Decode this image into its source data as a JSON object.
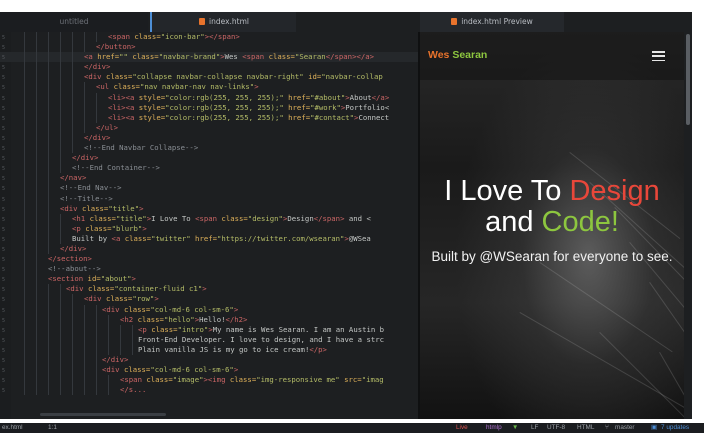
{
  "tabs": {
    "untitled": "untitled",
    "index": "index.html",
    "preview": "index.html Preview"
  },
  "editor": {
    "lines": [
      {
        "indent": 108,
        "tokens": [
          [
            "t",
            "<span"
          ],
          [
            "a",
            " class="
          ],
          [
            "s",
            "\"icon-bar\""
          ],
          [
            "t",
            "></span>"
          ]
        ]
      },
      {
        "indent": 96,
        "tokens": [
          [
            "t",
            "</button>"
          ]
        ]
      },
      {
        "indent": 84,
        "tokens": [
          [
            "t",
            "<a"
          ],
          [
            "a",
            " href="
          ],
          [
            "s",
            "\"\""
          ],
          [
            "a",
            " class="
          ],
          [
            "s",
            "\"navbar-brand\""
          ],
          [
            "t",
            ">"
          ],
          [
            "x",
            "Wes "
          ],
          [
            "t",
            "<span"
          ],
          [
            "a",
            " class="
          ],
          [
            "s",
            "\"Searan"
          ],
          [
            "t",
            "</span></a>"
          ]
        ]
      },
      {
        "indent": 84,
        "tokens": [
          [
            "t",
            "</div>"
          ]
        ]
      },
      {
        "indent": 84,
        "tokens": [
          [
            "t",
            "<div"
          ],
          [
            "a",
            " class="
          ],
          [
            "s",
            "\"collapse navbar-collapse navbar-right\""
          ],
          [
            "a",
            " id="
          ],
          [
            "s",
            "\"navbar-collap"
          ]
        ]
      },
      {
        "indent": 96,
        "tokens": [
          [
            "t",
            "<ul"
          ],
          [
            "a",
            " class="
          ],
          [
            "s",
            "\"nav navbar-nav nav-links\""
          ],
          [
            "t",
            ">"
          ]
        ]
      },
      {
        "indent": 108,
        "tokens": [
          [
            "t",
            "<li><a"
          ],
          [
            "a",
            " style="
          ],
          [
            "s",
            "\"color:rgb(255, 255, 255);\""
          ],
          [
            "a",
            " href="
          ],
          [
            "s",
            "\"#about\""
          ],
          [
            "t",
            ">"
          ],
          [
            "x",
            "About"
          ],
          [
            "t",
            "</a>"
          ]
        ]
      },
      {
        "indent": 108,
        "tokens": [
          [
            "t",
            "<li><a"
          ],
          [
            "a",
            " style="
          ],
          [
            "s",
            "\"color:rgb(255, 255, 255);\""
          ],
          [
            "a",
            " href="
          ],
          [
            "s",
            "\"#work\""
          ],
          [
            "t",
            ">"
          ],
          [
            "x",
            "Portfolio<"
          ]
        ]
      },
      {
        "indent": 108,
        "tokens": [
          [
            "t",
            "<li><a"
          ],
          [
            "a",
            " style="
          ],
          [
            "s",
            "\"color:rgb(255, 255, 255);\""
          ],
          [
            "a",
            " href="
          ],
          [
            "s",
            "\"#contact\""
          ],
          [
            "t",
            ">"
          ],
          [
            "x",
            "Connect"
          ]
        ]
      },
      {
        "indent": 96,
        "tokens": [
          [
            "t",
            "</ul>"
          ]
        ]
      },
      {
        "indent": 84,
        "tokens": [
          [
            "t",
            "</div>"
          ]
        ]
      },
      {
        "indent": 84,
        "tokens": [
          [
            "c",
            "<!--End Navbar Collapse-->"
          ]
        ]
      },
      {
        "indent": 72,
        "tokens": [
          [
            "t",
            "</div>"
          ]
        ]
      },
      {
        "indent": 72,
        "tokens": [
          [
            "c",
            "<!--End Container-->"
          ]
        ]
      },
      {
        "indent": 60,
        "tokens": [
          [
            "t",
            "</nav>"
          ]
        ]
      },
      {
        "indent": 60,
        "tokens": [
          [
            "c",
            "<!--End Nav-->"
          ]
        ]
      },
      {
        "indent": 60,
        "tokens": [
          [
            "c",
            "<!--Title-->"
          ]
        ]
      },
      {
        "indent": 60,
        "tokens": [
          [
            "t",
            "<div"
          ],
          [
            "a",
            " class="
          ],
          [
            "s",
            "\"title\""
          ],
          [
            "t",
            ">"
          ]
        ]
      },
      {
        "indent": 72,
        "tokens": [
          [
            "t",
            "<h1"
          ],
          [
            "a",
            " class="
          ],
          [
            "s",
            "\"title\""
          ],
          [
            "t",
            ">"
          ],
          [
            "x",
            "I Love To "
          ],
          [
            "t",
            "<span"
          ],
          [
            "a",
            " class="
          ],
          [
            "s",
            "\"design\""
          ],
          [
            "t",
            ">"
          ],
          [
            "x",
            "Design"
          ],
          [
            "t",
            "</span>"
          ],
          [
            "x",
            " and <"
          ]
        ]
      },
      {
        "indent": 72,
        "tokens": [
          [
            "t",
            "<p"
          ],
          [
            "a",
            " class="
          ],
          [
            "s",
            "\"blurb\""
          ],
          [
            "t",
            ">"
          ]
        ]
      },
      {
        "indent": 72,
        "tokens": [
          [
            "x",
            "Built by "
          ],
          [
            "t",
            "<a"
          ],
          [
            "a",
            " class="
          ],
          [
            "s",
            "\"twitter\""
          ],
          [
            "a",
            " href="
          ],
          [
            "s",
            "\"https://twitter.com/wsearan\""
          ],
          [
            "t",
            ">"
          ],
          [
            "x",
            "@WSea"
          ]
        ]
      },
      {
        "indent": 60,
        "tokens": [
          [
            "t",
            "</div>"
          ]
        ]
      },
      {
        "indent": 48,
        "tokens": [
          [
            "t",
            "</section>"
          ]
        ]
      },
      {
        "indent": 48,
        "tokens": [
          [
            "c",
            "<!--about-->"
          ]
        ]
      },
      {
        "indent": 48,
        "tokens": [
          [
            "t",
            "<section"
          ],
          [
            "a",
            " id="
          ],
          [
            "s",
            "\"about\""
          ],
          [
            "t",
            ">"
          ]
        ]
      },
      {
        "indent": 66,
        "tokens": [
          [
            "t",
            "<div"
          ],
          [
            "a",
            " class="
          ],
          [
            "s",
            "\"container-fluid c1\""
          ],
          [
            "t",
            ">"
          ]
        ]
      },
      {
        "indent": 84,
        "tokens": [
          [
            "t",
            "<div"
          ],
          [
            "a",
            " class="
          ],
          [
            "s",
            "\"row\""
          ],
          [
            "t",
            ">"
          ]
        ]
      },
      {
        "indent": 102,
        "tokens": [
          [
            "t",
            "<div"
          ],
          [
            "a",
            " class="
          ],
          [
            "s",
            "\"col-md-6 col-sm-6\""
          ],
          [
            "t",
            ">"
          ]
        ]
      },
      {
        "indent": 120,
        "tokens": [
          [
            "t",
            "<h2"
          ],
          [
            "a",
            " class="
          ],
          [
            "s",
            "\"hello\""
          ],
          [
            "t",
            ">"
          ],
          [
            "x",
            "Hello!"
          ],
          [
            "t",
            "</h2>"
          ]
        ]
      },
      {
        "indent": 138,
        "tokens": [
          [
            "t",
            "<p"
          ],
          [
            "a",
            " class="
          ],
          [
            "s",
            "\"intro\""
          ],
          [
            "t",
            ">"
          ],
          [
            "x",
            "My name is Wes Searan. I am an Austin b"
          ]
        ]
      },
      {
        "indent": 138,
        "tokens": [
          [
            "x",
            "Front-End Developer. I love to design, and I have a strc"
          ]
        ]
      },
      {
        "indent": 138,
        "tokens": [
          [
            "x",
            "Plain vanilla JS is my go to ice cream!"
          ],
          [
            "t",
            "</p>"
          ]
        ]
      },
      {
        "indent": 102,
        "tokens": [
          [
            "t",
            "</div>"
          ]
        ]
      },
      {
        "indent": 102,
        "tokens": [
          [
            "t",
            "<div"
          ],
          [
            "a",
            " class="
          ],
          [
            "s",
            "\"col-md-6 col-sm-6\""
          ],
          [
            "t",
            ">"
          ]
        ]
      },
      {
        "indent": 120,
        "tokens": [
          [
            "t",
            "<span"
          ],
          [
            "a",
            " class="
          ],
          [
            "s",
            "\"image\""
          ],
          [
            "t",
            "><img"
          ],
          [
            "a",
            " class="
          ],
          [
            "s",
            "\"img-responsive me\""
          ],
          [
            "a",
            " src="
          ],
          [
            "s",
            "\"imag"
          ]
        ]
      },
      {
        "indent": 120,
        "tokens": [
          [
            "t",
            "</s..."
          ]
        ]
      }
    ]
  },
  "preview": {
    "brand_first": "Wes ",
    "brand_last": "Searan",
    "hero_line1_a": "I Love To ",
    "hero_line1_b": "Design",
    "hero_line2_a": "and ",
    "hero_line2_b": "Code!",
    "blurb": "Built by @WSearan for everyone to see."
  },
  "statusbar": {
    "file": "ex.html",
    "position": "1:1",
    "live": "Live",
    "htmlp": "htmlp",
    "tri": "▼",
    "lf": "LF",
    "encoding": "UTF-8",
    "grammar": "HTML",
    "branch": "master",
    "updates": "7 updates"
  },
  "colors": {
    "accent_orange": "#e8732c",
    "design_red": "#e8473a",
    "code_green": "#8dc63f",
    "editor_bg": "#1d1f21"
  }
}
